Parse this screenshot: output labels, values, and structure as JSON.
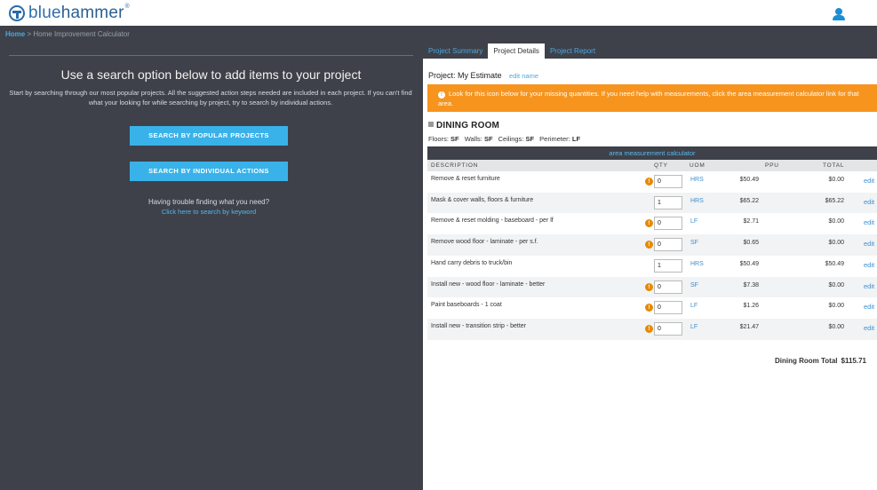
{
  "brand": {
    "name_light": "blue",
    "name_bold": "hammer",
    "tm": "®"
  },
  "breadcrumb": {
    "home": "Home",
    "separator": ">",
    "current": "Home Improvement Calculator"
  },
  "left": {
    "title": "Use a search option below to add items to your project",
    "description": "Start by searching through our most popular projects. All the suggested action steps needed are included in each project. If you can't find what your looking for while searching by project, try to search by individual actions.",
    "btn_popular": "SEARCH BY POPULAR PROJECTS",
    "btn_actions": "SEARCH BY INDIVIDUAL ACTIONS",
    "trouble": "Having trouble finding what you need?",
    "trouble_link": "Click here to search by keyword"
  },
  "tabs": [
    {
      "label": "Project Summary",
      "active": false
    },
    {
      "label": "Project Details",
      "active": true
    },
    {
      "label": "Project Report",
      "active": false
    }
  ],
  "project": {
    "label": "Project: My Estimate",
    "edit_name": "edit name"
  },
  "alert": {
    "icon": "!",
    "text": "Look for this icon below for your missing quantities. If you need help with measurements, click the area measurement calculator link for that area."
  },
  "room": {
    "title": "DINING ROOM",
    "floors_label": "Floors:",
    "floors_value": "SF",
    "walls_label": "Walls:",
    "walls_value": "SF",
    "ceilings_label": "Ceilings:",
    "ceilings_value": "SF",
    "perimeter_label": "Perimeter:",
    "perimeter_value": "LF",
    "calc_link": "area measurement calculator",
    "total_label": "Dining Room Total",
    "total_value": "$115.71"
  },
  "table": {
    "headers": {
      "description": "DESCRIPTION",
      "qty": "QTY",
      "uom": "UOM",
      "ppu": "PPU",
      "total": "TOTAL"
    },
    "edit_label": "edit",
    "warn_icon": "!",
    "rows": [
      {
        "description": "Remove & reset furniture",
        "qty": "0",
        "uom": "HRS",
        "ppu": "$50.49",
        "total": "$0.00",
        "warning": true
      },
      {
        "description": "Mask & cover walls, floors & furniture",
        "qty": "1",
        "uom": "HRS",
        "ppu": "$65.22",
        "total": "$65.22",
        "warning": false
      },
      {
        "description": "Remove & reset molding - baseboard - per lf",
        "qty": "0",
        "uom": "LF",
        "ppu": "$2.71",
        "total": "$0.00",
        "warning": true
      },
      {
        "description": "Remove wood floor - laminate - per s.f.",
        "qty": "0",
        "uom": "SF",
        "ppu": "$0.65",
        "total": "$0.00",
        "warning": true
      },
      {
        "description": "Hand carry debris to truck/bin",
        "qty": "1",
        "uom": "HRS",
        "ppu": "$50.49",
        "total": "$50.49",
        "warning": false
      },
      {
        "description": "Install new - wood floor - laminate - better",
        "qty": "0",
        "uom": "SF",
        "ppu": "$7.38",
        "total": "$0.00",
        "warning": true
      },
      {
        "description": "Paint baseboards - 1 coat",
        "qty": "0",
        "uom": "LF",
        "ppu": "$1.26",
        "total": "$0.00",
        "warning": true
      },
      {
        "description": "Install new - transition strip - better",
        "qty": "0",
        "uom": "LF",
        "ppu": "$21.47",
        "total": "$0.00",
        "warning": true
      }
    ]
  },
  "colors": {
    "dark_bg": "#3e4149",
    "accent_blue": "#39b2ea",
    "alert_orange": "#f7941d",
    "link_blue": "#4aa8e0"
  }
}
